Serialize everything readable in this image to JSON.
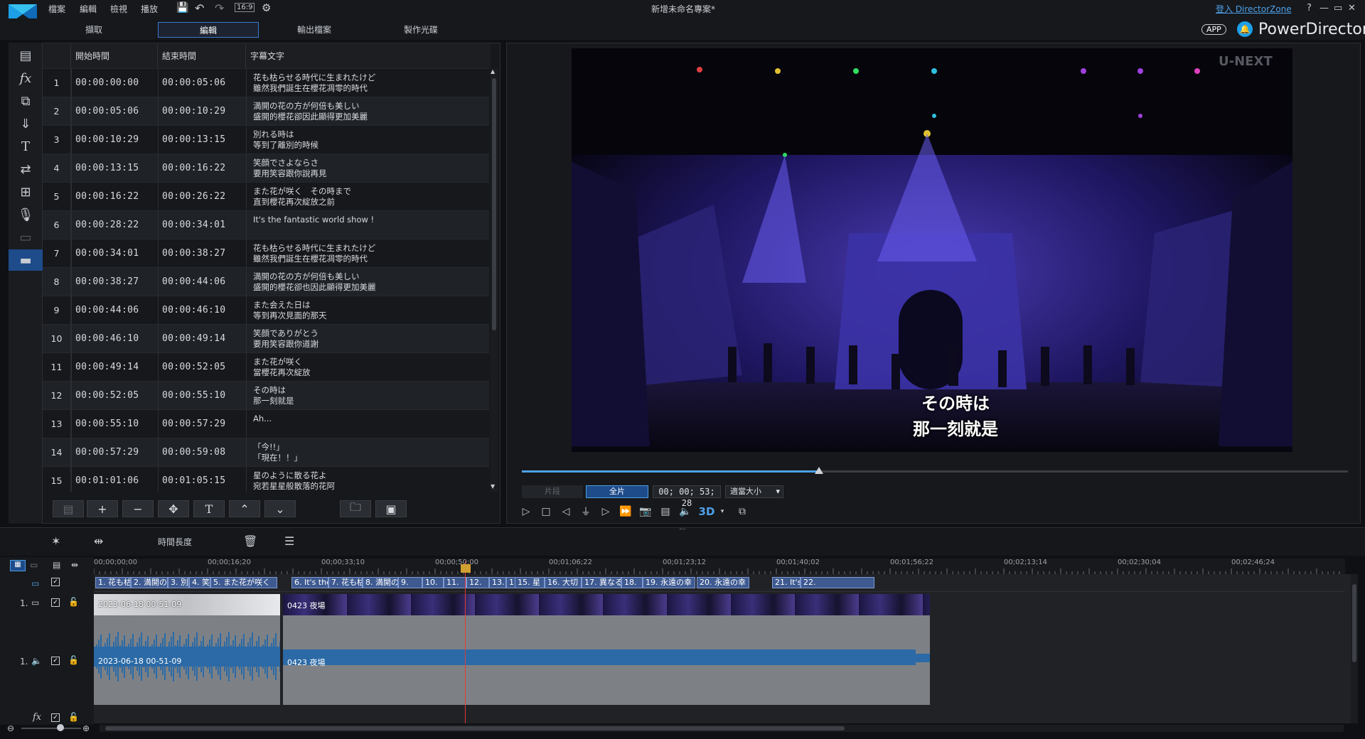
{
  "titlebar": {
    "project_title": "新增未命名專案*",
    "login_link": "登入 DirectorZone",
    "menu": [
      "檔案",
      "編輯",
      "檢視",
      "播放"
    ],
    "aspect": "16:9",
    "window_controls": [
      "?",
      "—",
      "▭",
      "✕"
    ]
  },
  "tabs": [
    "擷取",
    "編輯",
    "輸出檔案",
    "製作光碟"
  ],
  "brand": {
    "app_badge": "APP",
    "name": "PowerDirector"
  },
  "subtitle_table": {
    "headers": [
      "開始時間",
      "結束時間",
      "字幕文字"
    ],
    "rows": [
      {
        "n": "1",
        "start": "00:00:00:00",
        "end": "00:00:05:06",
        "l1": "花も枯らせる時代に生まれたけど",
        "l2": "雖然我們誕生在櫻花凋零的時代"
      },
      {
        "n": "2",
        "start": "00:00:05:06",
        "end": "00:00:10:29",
        "l1": "満開の花の方が何倍も美しい",
        "l2": "盛開的櫻花卻因此顯得更加美麗"
      },
      {
        "n": "3",
        "start": "00:00:10:29",
        "end": "00:00:13:15",
        "l1": "別れる時は",
        "l2": "等到了離別的時候"
      },
      {
        "n": "4",
        "start": "00:00:13:15",
        "end": "00:00:16:22",
        "l1": "笑顔でさよならさ",
        "l2": "要用笑容跟你說再見"
      },
      {
        "n": "5",
        "start": "00:00:16:22",
        "end": "00:00:26:22",
        "l1": "また花が咲く　その時まで",
        "l2": "直到櫻花再次綻放之前"
      },
      {
        "n": "6",
        "start": "00:00:28:22",
        "end": "00:00:34:01",
        "l1": "It's the fantastic world show !",
        "l2": ""
      },
      {
        "n": "7",
        "start": "00:00:34:01",
        "end": "00:00:38:27",
        "l1": "花も枯らせる時代に生まれたけど",
        "l2": "雖然我們誕生在櫻花凋零的時代"
      },
      {
        "n": "8",
        "start": "00:00:38:27",
        "end": "00:00:44:06",
        "l1": "満開の花の方が何倍も美しい",
        "l2": "盛開的櫻花卻也因此顯得更加美麗"
      },
      {
        "n": "9",
        "start": "00:00:44:06",
        "end": "00:00:46:10",
        "l1": "また会えた日は",
        "l2": "等到再次見面的那天"
      },
      {
        "n": "10",
        "start": "00:00:46:10",
        "end": "00:00:49:14",
        "l1": "笑顔でありがとう",
        "l2": "要用笑容跟你道謝"
      },
      {
        "n": "11",
        "start": "00:00:49:14",
        "end": "00:00:52:05",
        "l1": "また花が咲く",
        "l2": "當櫻花再次綻放"
      },
      {
        "n": "12",
        "start": "00:00:52:05",
        "end": "00:00:55:10",
        "l1": "その時は",
        "l2": "那一刻就是"
      },
      {
        "n": "13",
        "start": "00:00:55:10",
        "end": "00:00:57:29",
        "l1": "Ah...",
        "l2": ""
      },
      {
        "n": "14",
        "start": "00:00:57:29",
        "end": "00:00:59:08",
        "l1": "「今!!」",
        "l2": "「現在！！」"
      },
      {
        "n": "15",
        "start": "00:01:01:06",
        "end": "00:01:05:15",
        "l1": "星のように散る花よ",
        "l2": "宛若星星般散落的花阿"
      }
    ]
  },
  "preview": {
    "watermark": "U-NEXT",
    "subtitle_line1": "その時は",
    "subtitle_line2": "那一刻就是",
    "mode_clip": "片段",
    "mode_movie": "全片",
    "timecode": "00; 00; 53; 28",
    "fit_label": "適當大小",
    "label_3d": "3D",
    "progress": 0.36
  },
  "timeline_toolbar": {
    "duration_label": "時間長度"
  },
  "ruler": [
    "00;00;00;00",
    "00;00;16;20",
    "00;00;33;10",
    "00;00;50;00",
    "00;01;06;22",
    "00;01;23;12",
    "00;01;40;02",
    "00;01;56;22",
    "00;02;13;14",
    "00;02;30;04",
    "00;02;46;24"
  ],
  "subtitle_clips": [
    "1. 花も枯",
    "2. 満開の",
    "3. 別",
    "4. 笑",
    "5. また花が咲く",
    "6. It's the",
    "7. 花も枯",
    "8. 満開の",
    "9.",
    "10.",
    "11.",
    "12.",
    "13.",
    "1",
    "15. 星",
    "16. 大切",
    "17. 異なる",
    "18.",
    "19. 永遠の幸",
    "20. 永遠の幸",
    "21. It's th",
    "22."
  ],
  "tracks": {
    "video_track_label": "1.",
    "audio_track_label": "1.",
    "clip1_name": "2023-06-18 00-51-09",
    "clip2_name": "0423 夜場",
    "audio1_name": "2023-06-18 00-51-09",
    "audio2_name": "0423 夜場",
    "fx_label": "fx"
  }
}
